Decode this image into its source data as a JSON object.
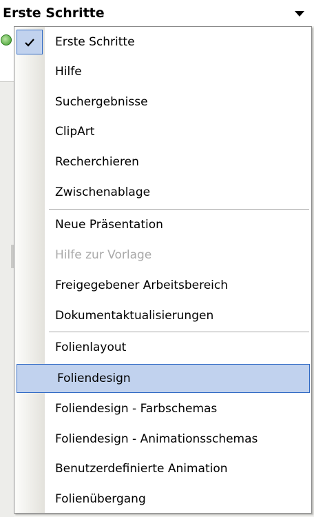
{
  "header": {
    "title": "Erste Schritte",
    "dropdown_icon": "triangle-down"
  },
  "menu": {
    "items": [
      {
        "label": "Erste Schritte",
        "checked": true,
        "disabled": false
      },
      {
        "label": "Hilfe",
        "checked": false,
        "disabled": false
      },
      {
        "label": "Suchergebnisse",
        "checked": false,
        "disabled": false
      },
      {
        "label": "ClipArt",
        "checked": false,
        "disabled": false
      },
      {
        "label": "Recherchieren",
        "checked": false,
        "disabled": false
      },
      {
        "label": "Zwischenablage",
        "checked": false,
        "disabled": false
      },
      {
        "label": "Neue Präsentation",
        "checked": false,
        "disabled": false
      },
      {
        "label": "Hilfe zur Vorlage",
        "checked": false,
        "disabled": true
      },
      {
        "label": "Freigegebener Arbeitsbereich",
        "checked": false,
        "disabled": false
      },
      {
        "label": "Dokumentaktualisierungen",
        "checked": false,
        "disabled": false
      },
      {
        "label": "Folienlayout",
        "checked": false,
        "disabled": false
      },
      {
        "label": "Foliendesign",
        "checked": false,
        "disabled": false,
        "highlighted": true
      },
      {
        "label": "Foliendesign - Farbschemas",
        "checked": false,
        "disabled": false
      },
      {
        "label": "Foliendesign - Animationsschemas",
        "checked": false,
        "disabled": false
      },
      {
        "label": "Benutzerdefinierte Animation",
        "checked": false,
        "disabled": false
      },
      {
        "label": "Folienübergang",
        "checked": false,
        "disabled": false
      }
    ]
  },
  "colors": {
    "highlight_fill": "#c1d2ee",
    "highlight_border": "#316ac5",
    "disabled_text": "#a9a9a9"
  }
}
